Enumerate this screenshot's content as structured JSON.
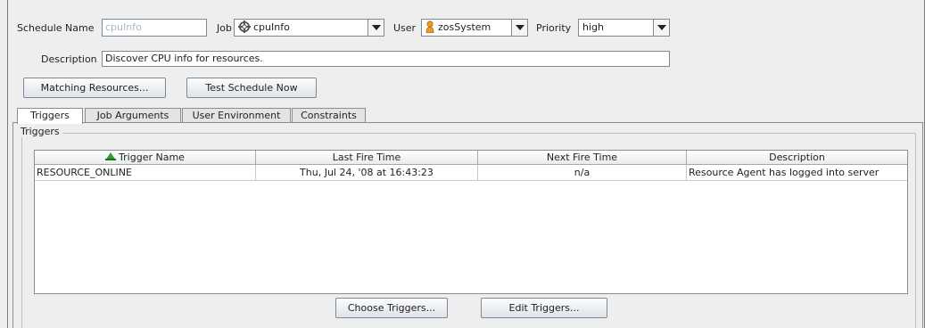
{
  "schedule": {
    "name_label": "Schedule Name",
    "name_value": "cpuInfo",
    "job_label": "Job",
    "job_value": "cpuInfo",
    "user_label": "User",
    "user_value": "zosSystem",
    "priority_label": "Priority",
    "priority_value": "high",
    "description_label": "Description",
    "description_value": "Discover CPU info for resources."
  },
  "buttons": {
    "matching_resources": "Matching Resources...",
    "test_schedule_now": "Test Schedule Now",
    "choose_triggers": "Choose Triggers...",
    "edit_triggers": "Edit Triggers..."
  },
  "tabs": [
    {
      "label": "Triggers",
      "active": true
    },
    {
      "label": "Job Arguments",
      "active": false
    },
    {
      "label": "User Environment",
      "active": false
    },
    {
      "label": "Constraints",
      "active": false
    }
  ],
  "triggers_group": {
    "title": "Triggers",
    "columns": [
      "Trigger Name",
      "Last Fire Time",
      "Next Fire Time",
      "Description"
    ],
    "rows": [
      [
        "RESOURCE_ONLINE",
        "Thu, Jul 24, '08 at 16:43:23",
        "n/a",
        "Resource Agent has logged into server"
      ]
    ]
  },
  "icons": {
    "job": "gear-icon",
    "user": "user-icon",
    "sort": "sort-ascending-icon"
  },
  "colors": {
    "panel_bg": "#eeeeee",
    "disabled_text": "#a9b8c8",
    "sort_icon": "#2e9e2e",
    "user_icon": "#e8a020"
  }
}
